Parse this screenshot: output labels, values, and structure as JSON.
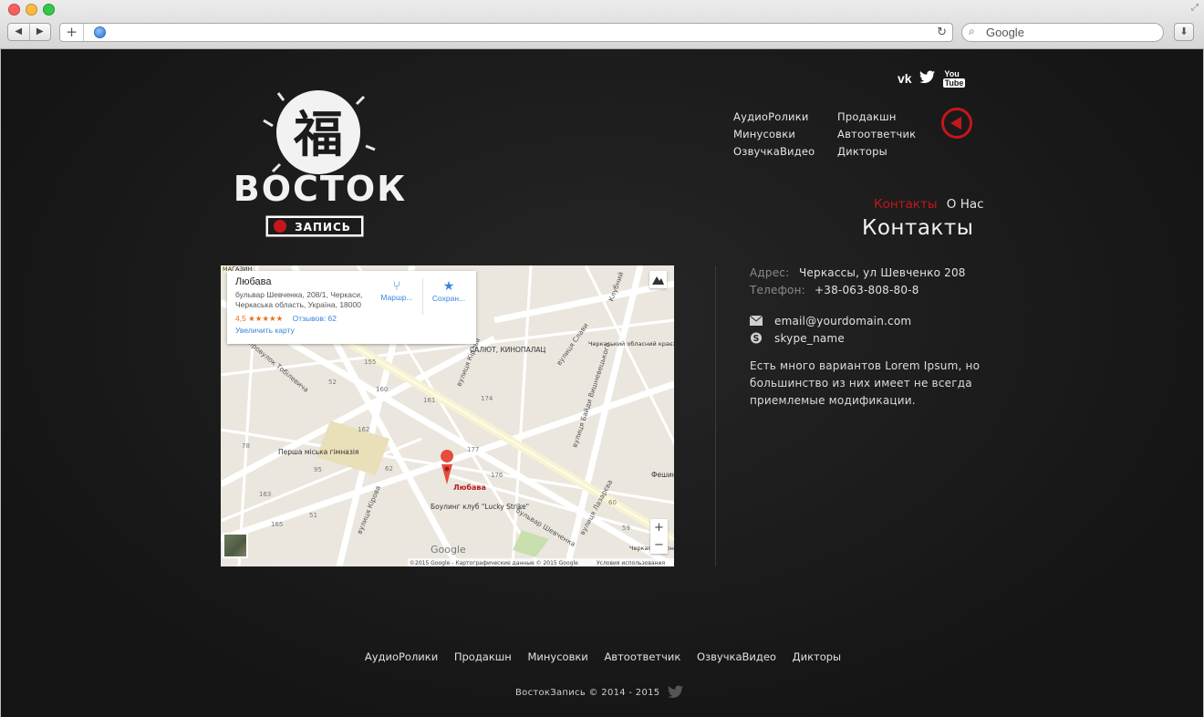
{
  "browser": {
    "search_placeholder": "Google",
    "back_icon": "◀",
    "forward_icon": "▶",
    "new_tab_icon": "+",
    "reload_icon": "↻",
    "download_icon": "⬇"
  },
  "site": {
    "logo_name": "ВОСТОК",
    "logo_sub": "ЗАПИСЬ",
    "social": [
      "VK",
      "Twitter",
      "YouTube"
    ],
    "nav": [
      "АудиоРолики",
      "Продакшн",
      "Минусовки",
      "Автоответчик",
      "ОзвучкаВидео",
      "Дикторы"
    ],
    "breadcrumb": {
      "active": "Контакты",
      "other": "О Нас"
    },
    "page_title": "Контакты",
    "contact": {
      "address_label": "Адрес:",
      "address": "Черкассы, ул Шевченко 208",
      "phone_label": "Телефон:",
      "phone": "+38-063-808-80-8",
      "email": "email@yourdomain.com",
      "skype": "skype_name",
      "description": "Есть много вариантов Lorem Ipsum, но большинство из них имеет не всегда приемлемые модификации."
    },
    "map": {
      "place_name": "Любава",
      "place_address": "бульвар Шевченка, 208/1, Черкаси, Черкаська область, Україна, 18000",
      "rating": "4,5 ★★★★★",
      "reviews": "Отзывов: 62",
      "enlarge": "Увеличить карту",
      "route": "Маршр...",
      "save": "Сохран...",
      "pin_label": "Любава",
      "poi": [
        "Перша міська гімназія",
        "Боулинг клуб \"Lucky Strike\"",
        "САЛЮТ, КИНОПАЛАЦ",
        "Черкаський обласний краєзнавчий музей",
        "Фешин",
        "Черкас національн",
        "МАГАЗИН"
      ],
      "streets": [
        "вулиця Кірова",
        "вулиця Слави",
        "провулок Тобілевича",
        "бульвар Шевченка",
        "вулиця Лазарєва",
        "вулиця Байди Вишневецького",
        "Клубний",
        "вулиця Кірова"
      ],
      "numbers": [
        "155",
        "161",
        "160",
        "177",
        "162",
        "163",
        "165",
        "174",
        "176",
        "59",
        "60",
        "62",
        "95",
        "52",
        "78",
        "51"
      ],
      "zoom_in": "+",
      "zoom_out": "−",
      "google": "Google",
      "attribution": "©2015 Google - Картографические данные © 2015 Google",
      "terms": "Условия использования"
    },
    "footer_nav": [
      "АудиоРолики",
      "Продакшн",
      "Минусовки",
      "Автоответчик",
      "ОзвучкаВидео",
      "Дикторы"
    ],
    "copyright": "ВостокЗапись © 2014 - 2015"
  }
}
